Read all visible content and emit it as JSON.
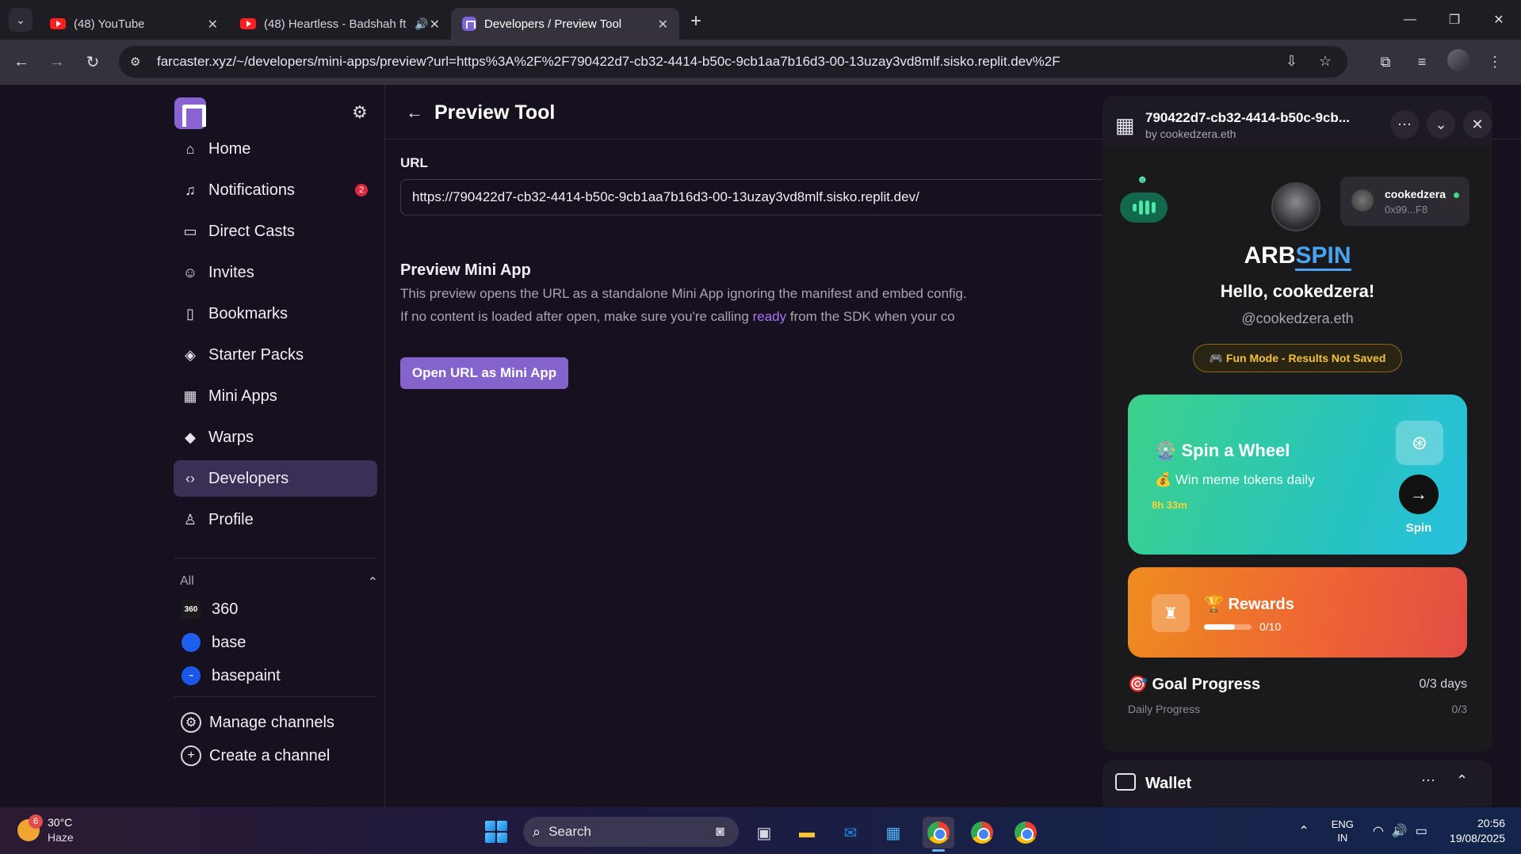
{
  "browser": {
    "tabs": [
      {
        "title": "(48) YouTube",
        "close": "✕"
      },
      {
        "title": "(48) Heartless - Badshah ft.",
        "close": "✕"
      },
      {
        "title": "Developers / Preview Tool",
        "close": "✕"
      }
    ],
    "new_tab": "+",
    "address": "farcaster.xyz/~/developers/mini-apps/preview?url=https%3A%2F%2F790422d7-cb32-4414-b50c-9cb1aa7b16d3-00-13uzay3vd8mlf.sisko.replit.dev%2F"
  },
  "sidebar": {
    "items": [
      {
        "label": "Home",
        "icon": "home-icon"
      },
      {
        "label": "Notifications",
        "icon": "bell-icon",
        "badge": "2"
      },
      {
        "label": "Direct Casts",
        "icon": "chat-icon"
      },
      {
        "label": "Invites",
        "icon": "users-icon"
      },
      {
        "label": "Bookmarks",
        "icon": "bookmark-icon"
      },
      {
        "label": "Starter Packs",
        "icon": "package-icon"
      },
      {
        "label": "Mini Apps",
        "icon": "grid-icon"
      },
      {
        "label": "Warps",
        "icon": "diamond-icon"
      },
      {
        "label": "Developers",
        "icon": "code-icon"
      },
      {
        "label": "Profile",
        "icon": "person-icon"
      }
    ],
    "section_label": "All",
    "channels": [
      {
        "name": "360",
        "color": "#1b1b1b",
        "icon_text": "360"
      },
      {
        "name": "base",
        "color": "#1f5ff0",
        "icon_text": ""
      },
      {
        "name": "basepaint",
        "color": "#1c58e8",
        "icon_text": ""
      }
    ],
    "actions": [
      {
        "label": "Manage channels"
      },
      {
        "label": "Create a channel"
      }
    ]
  },
  "main": {
    "title": "Preview Tool",
    "url_label": "URL",
    "url_value": "https://790422d7-cb32-4414-b50c-9cb1aa7b16d3-00-13uzay3vd8mlf.sisko.replit.dev/",
    "preview_title": "Preview Mini App",
    "desc1": "This preview opens the URL as a standalone Mini App ignoring the manifest and embed config.",
    "desc2_pre": "If no content is loaded after open, make sure you're calling ",
    "desc2_link": "ready",
    "desc2_post": " from the SDK when your content is ready to be d",
    "open_button": "Open URL as Mini App"
  },
  "miniapp": {
    "title": "790422d7-cb32-4414-b50c-9cb...",
    "subtitle": "by cookedzera.eth",
    "user_name": "cookedzera",
    "user_addr": "0x99...F8",
    "brand_a": "ARB",
    "brand_b": "SPIN",
    "hello": "Hello, cookedzera!",
    "handle": "@cookedzera.eth",
    "fun_mode": "🎮 Fun Mode - Results Not Saved",
    "spin_title": "🎡 Spin a Wheel",
    "spin_sub": "💰 Win meme tokens daily",
    "spin_timer": "8h 33m",
    "spin_label": "Spin",
    "rewards_title": "🏆 Rewards",
    "rewards_count": "0/10",
    "rewards_progress": 0.65,
    "goal_title": "🎯 Goal Progress",
    "goal_days": "0/3 days",
    "daily_label": "Daily Progress",
    "daily_value": "0/3"
  },
  "wallet": {
    "label": "Wallet"
  },
  "taskbar": {
    "temp": "30°C",
    "condition": "Haze",
    "weather_badge": "6",
    "search": "Search",
    "lang1": "ENG",
    "lang2": "IN",
    "time": "20:56",
    "date": "19/08/2025"
  }
}
